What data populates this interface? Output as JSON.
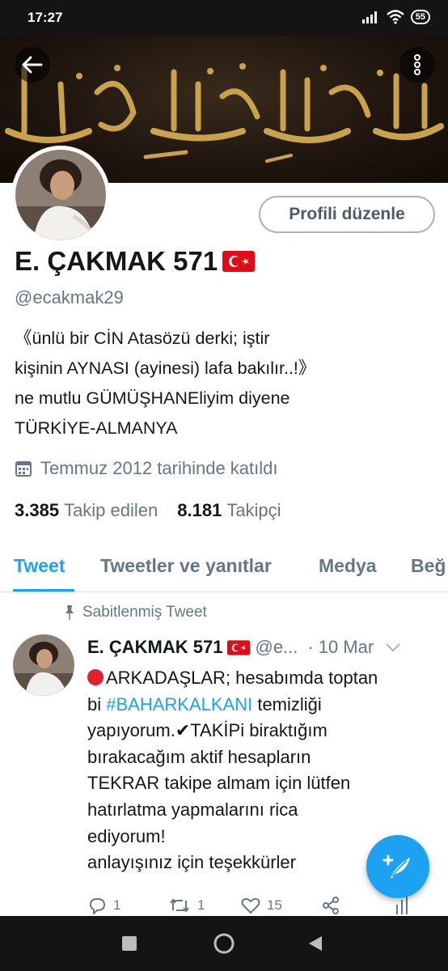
{
  "status_bar": {
    "time": "17:27",
    "battery": "55"
  },
  "profile": {
    "edit_button": "Profili düzenle",
    "name": "E. ÇAKMAK 571",
    "handle": "@ecakmak29",
    "bio_lines": [
      "《ünlü bir  CİN  Atasözü derki; iştir",
      "kişinin AYNASI (ayinesi) lafa bakılır..!》",
      "ne mutlu GÜMÜŞHANEliyim diyene",
      "TÜRKİYE-ALMANYA"
    ],
    "joined": "Temmuz 2012 tarihinde katıldı",
    "following_count": "3.385",
    "following_label": "Takip edilen",
    "followers_count": "8.181",
    "followers_label": "Takipçi"
  },
  "tabs": [
    {
      "label": "Tweet",
      "active": true
    },
    {
      "label": "Tweetler ve yanıtlar",
      "active": false
    },
    {
      "label": "Medya",
      "active": false
    },
    {
      "label": "Beğ",
      "active": false
    }
  ],
  "pinned_label": "Sabitlenmiş Tweet",
  "tweet": {
    "name": "E. ÇAKMAK 571",
    "handle": "@e...",
    "separator": "·",
    "date": "10 Mar",
    "line1_text": "ARKADAŞLAR; hesabımda toptan",
    "line2_prefix": "bi ",
    "hashtag": "#BAHARKALKANI",
    "line2_suffix": " temizliği",
    "line3": "yapıyorum.✔TAKİPi biraktığım",
    "line4": "bırakacağım aktif hesapların",
    "line5": "TEKRAR takipe almam için lütfen",
    "line6": "hatırlatma yapmalarını rica",
    "line7": "ediyorum!",
    "line8": "anlayışınız için teşekkürler",
    "replies": "1",
    "retweets": "1",
    "likes": "15"
  },
  "icons": {
    "back": "back-arrow-icon",
    "more": "more-vertical-icon",
    "calendar": "calendar-icon",
    "pin": "pin-icon",
    "reply": "reply-icon",
    "retweet": "retweet-icon",
    "like": "heart-icon",
    "share": "share-icon",
    "analytics": "analytics-icon",
    "compose": "compose-tweet-icon"
  },
  "colors": {
    "accent": "#1da1f2",
    "text": "#14171a",
    "muted": "#657786",
    "flag_red": "#e30a17"
  }
}
